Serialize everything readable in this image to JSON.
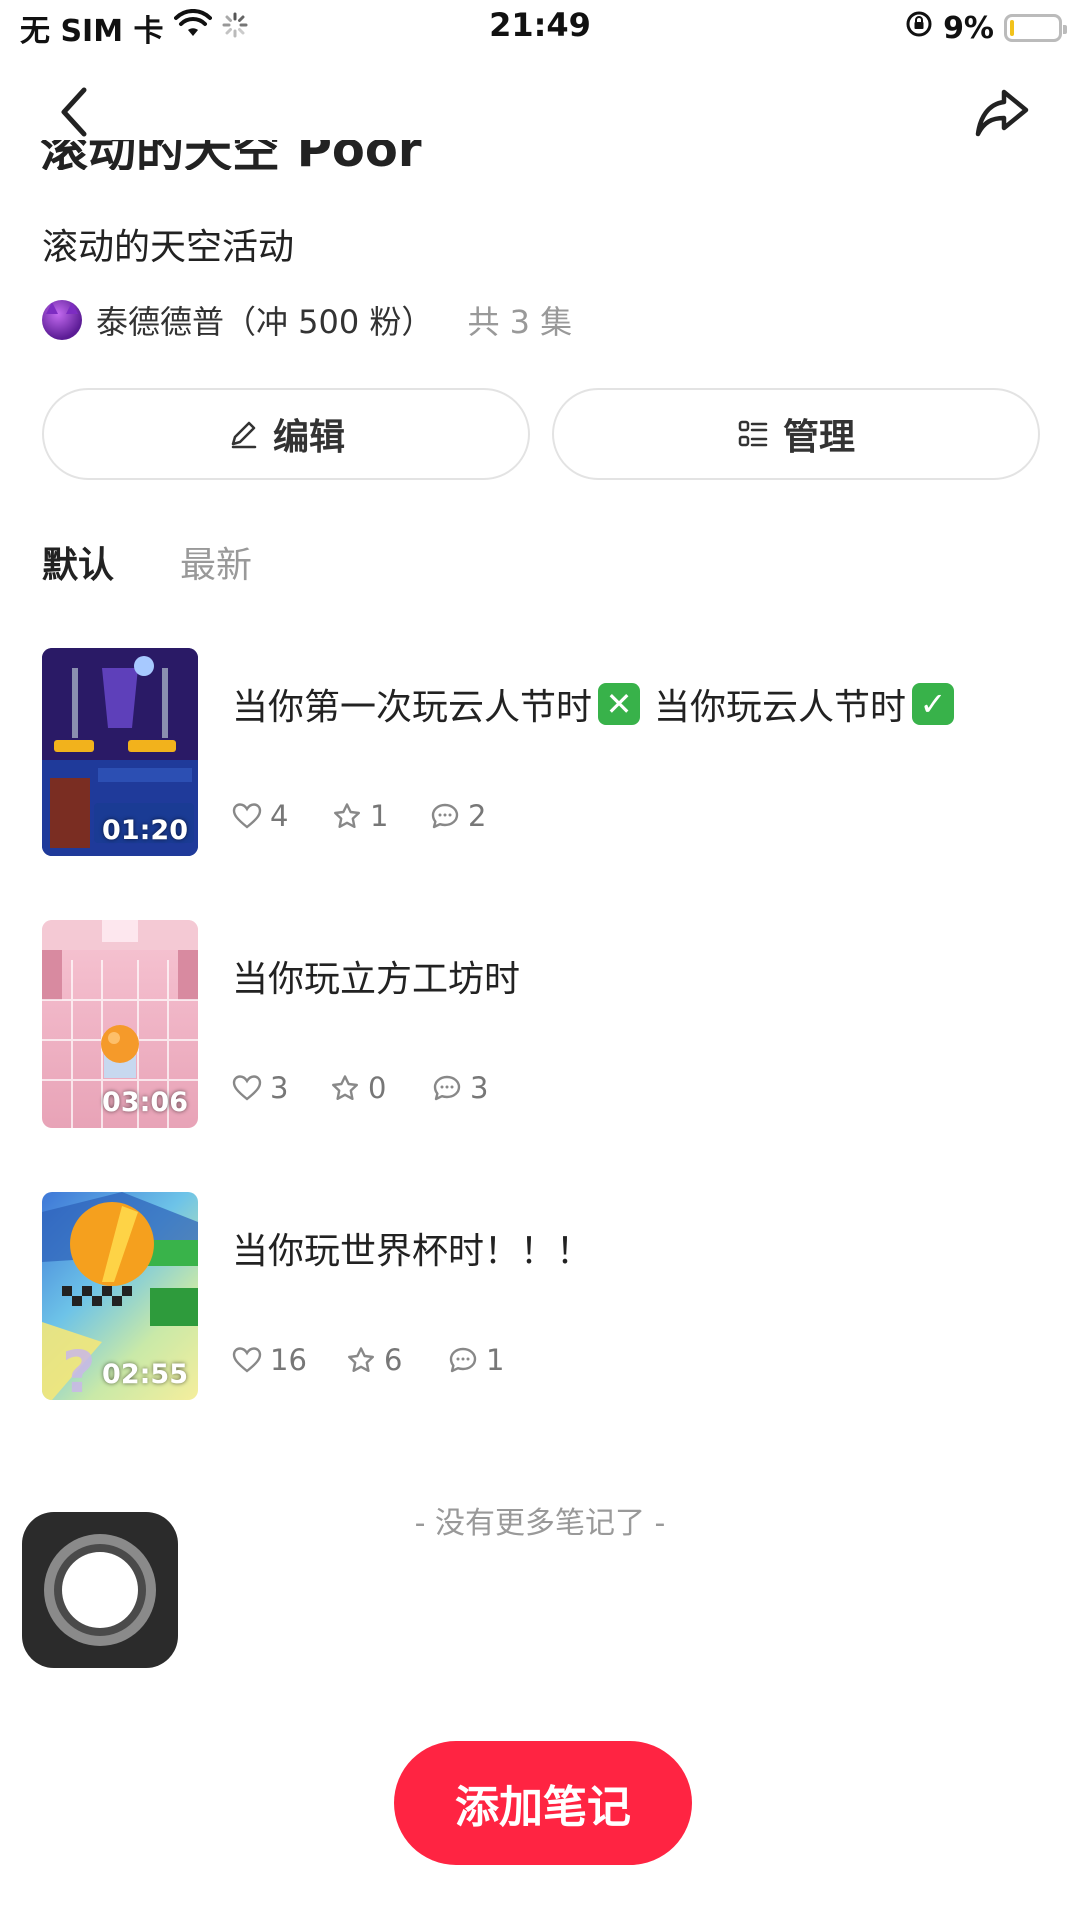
{
  "status_bar": {
    "carrier": "无 SIM 卡",
    "time": "21:49",
    "battery_text": "9%",
    "battery_level": 0.09,
    "battery_color": "#f2c21b"
  },
  "nav": {
    "back_icon": "chevron-left-icon",
    "share_icon": "share-icon"
  },
  "collection": {
    "title_cut": "滚动的天空 Poor",
    "subtitle": "滚动的天空活动",
    "author": "泰德德普（冲 500 粉）",
    "episode_count": "共 3 集"
  },
  "actions": {
    "edit_label": "编辑",
    "manage_label": "管理"
  },
  "sort": {
    "tabs": [
      "默认",
      "最新"
    ],
    "active": "默认"
  },
  "notes": [
    {
      "title_part1": "当你第一次玩云人节时",
      "emoji1": "✕",
      "title_part2": "当你玩云人节时",
      "emoji2": "✓",
      "duration": "01:20",
      "likes": "4",
      "stars": "1",
      "comments": "2"
    },
    {
      "title": "当你玩立方工坊时",
      "duration": "03:06",
      "likes": "3",
      "stars": "0",
      "comments": "3"
    },
    {
      "title": "当你玩世界杯时！！！",
      "duration": "02:55",
      "likes": "16",
      "stars": "6",
      "comments": "1"
    }
  ],
  "end_text": "- 没有更多笔记了 -",
  "add_note_label": "添加笔记",
  "colors": {
    "accent": "#ff2442",
    "muted": "#999999"
  }
}
